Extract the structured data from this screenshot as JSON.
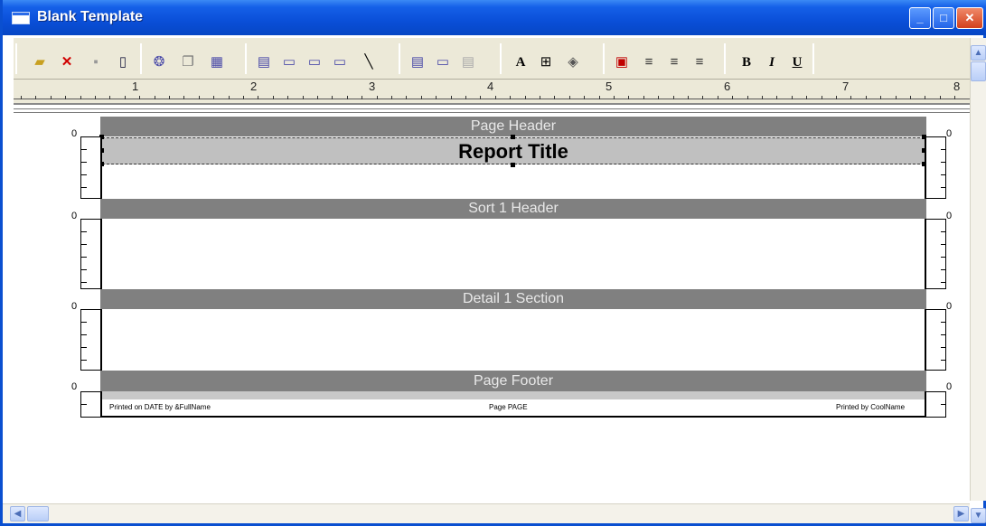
{
  "window": {
    "title": "Blank Template"
  },
  "toolbar": {
    "font_button": "A",
    "bold_button": "B",
    "italic_button": "I",
    "underline_button": "U"
  },
  "ruler": {
    "marks": [
      "1",
      "2",
      "3",
      "4",
      "5",
      "6",
      "7",
      "8"
    ]
  },
  "sections": {
    "page_header": "Page Header",
    "report_title": "Report Title",
    "sort_header": "Sort 1 Header",
    "detail": "Detail 1 Section",
    "page_footer": "Page Footer"
  },
  "footer_fields": {
    "left": "Printed on DATE   by &FullName",
    "center": "Page PAGE",
    "right": "Printed by CoolName"
  },
  "side_ruler": {
    "zero": "0"
  },
  "colors": {
    "titlebar": "#0a4fd8",
    "band": "#808080",
    "toolbar_bg": "#ece9d8"
  }
}
